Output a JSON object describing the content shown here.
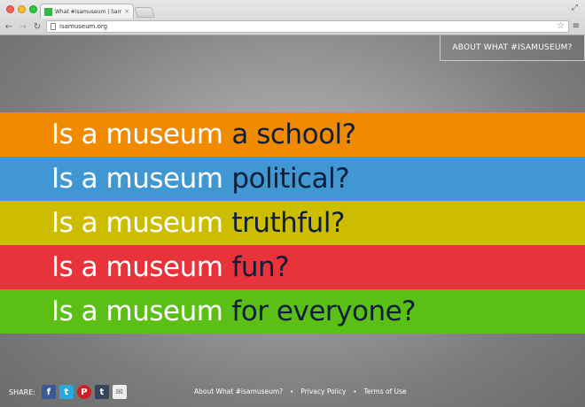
{
  "browser": {
    "tab_title": "What #isamuseum | Sam D",
    "tab_close": "×",
    "url": "isamuseum.org"
  },
  "header": {
    "about_label": "ABOUT WHAT #ISAMUSEUM?"
  },
  "questions": [
    {
      "lead": "Is a museum",
      "tail": "a school?",
      "color": "#f08a00"
    },
    {
      "lead": "Is a museum",
      "tail": "political?",
      "color": "#4197d1"
    },
    {
      "lead": "Is a museum",
      "tail": "truthful?",
      "color": "#cdbd00"
    },
    {
      "lead": "Is a museum",
      "tail": "fun?",
      "color": "#e8333a"
    },
    {
      "lead": "Is a museum",
      "tail": "for everyone?",
      "color": "#5cbf16"
    }
  ],
  "share": {
    "label": "SHARE:",
    "icons": [
      "facebook-icon",
      "twitter-icon",
      "pinterest-icon",
      "tumblr-icon",
      "email-icon"
    ],
    "glyphs": [
      "f",
      "t",
      "P",
      "t",
      "✉"
    ]
  },
  "footer": {
    "links": [
      "About What #isamuseum?",
      "Privacy Policy",
      "Terms of Use"
    ],
    "separator": "•"
  }
}
